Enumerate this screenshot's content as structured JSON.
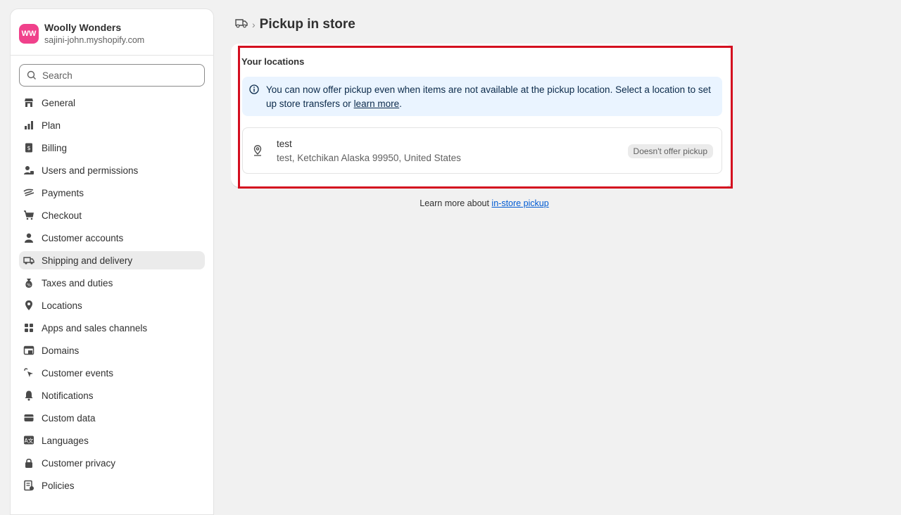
{
  "store": {
    "avatar": "WW",
    "name": "Woolly Wonders",
    "domain": "sajini-john.myshopify.com"
  },
  "search": {
    "placeholder": "Search"
  },
  "nav": [
    {
      "label": "General",
      "icon": "store-icon"
    },
    {
      "label": "Plan",
      "icon": "plan-icon"
    },
    {
      "label": "Billing",
      "icon": "billing-icon"
    },
    {
      "label": "Users and permissions",
      "icon": "users-icon"
    },
    {
      "label": "Payments",
      "icon": "payments-icon"
    },
    {
      "label": "Checkout",
      "icon": "cart-icon"
    },
    {
      "label": "Customer accounts",
      "icon": "person-icon"
    },
    {
      "label": "Shipping and delivery",
      "icon": "truck-icon",
      "active": true
    },
    {
      "label": "Taxes and duties",
      "icon": "tax-icon"
    },
    {
      "label": "Locations",
      "icon": "location-icon"
    },
    {
      "label": "Apps and sales channels",
      "icon": "apps-icon"
    },
    {
      "label": "Domains",
      "icon": "domains-icon"
    },
    {
      "label": "Customer events",
      "icon": "cursor-icon"
    },
    {
      "label": "Notifications",
      "icon": "bell-icon"
    },
    {
      "label": "Custom data",
      "icon": "data-icon"
    },
    {
      "label": "Languages",
      "icon": "languages-icon"
    },
    {
      "label": "Customer privacy",
      "icon": "lock-icon"
    },
    {
      "label": "Policies",
      "icon": "policies-icon"
    }
  ],
  "breadcrumb": {
    "separator": "›",
    "title": "Pickup in store"
  },
  "card": {
    "title": "Your locations",
    "banner_text": "You can now offer pickup even when items are not available at the pickup location. Select a location to set up store transfers or ",
    "banner_link": "learn more",
    "banner_end": ".",
    "location": {
      "name": "test",
      "address": "test, Ketchikan Alaska 99950, United States",
      "status": "Doesn't offer pickup"
    }
  },
  "footer": {
    "text": "Learn more about ",
    "link": "in-store pickup"
  },
  "colors": {
    "highlight": "#d40e1f",
    "banner": "#eaf4ff",
    "avatar": "#f0418b",
    "link": "#005bd3"
  }
}
